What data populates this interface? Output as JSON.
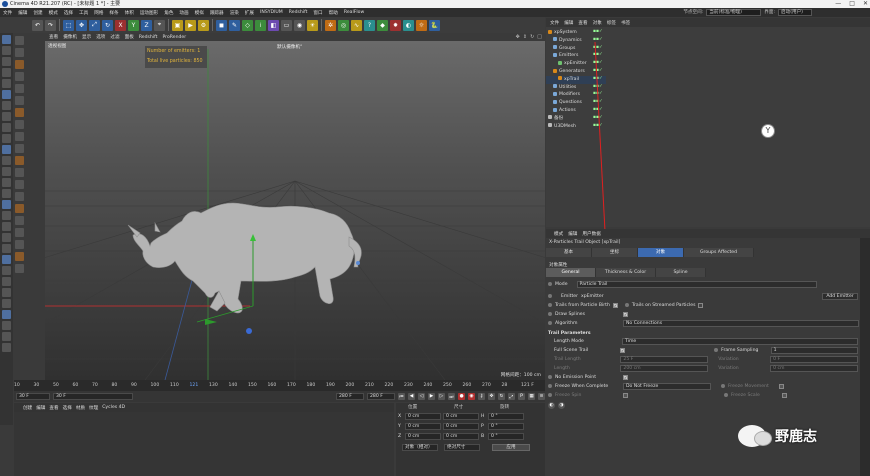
{
  "window": {
    "title": "Cinema 4D R21.207 (RC) - [未标题 1 *] - 主要",
    "controls": [
      "—",
      "□",
      "✕"
    ]
  },
  "menubar": {
    "items": [
      "文件",
      "编辑",
      "创建",
      "模式",
      "选择",
      "工具",
      "网格",
      "样条",
      "体积",
      "运动图形",
      "角色",
      "动画",
      "模拟",
      "跟踪器",
      "渲染",
      "扩展",
      "INSYDIUM",
      "Redshift",
      "窗口",
      "帮助",
      "RealFlow"
    ],
    "layout_label": "界面:",
    "layout_value": "启动(用户)",
    "node_label": "节点空间:",
    "node_value": "当前(标准/物理)"
  },
  "toolbar": {
    "icons": [
      "undo-icon",
      "redo-icon",
      "select-icon",
      "move-icon",
      "scale-icon",
      "rotate-icon",
      "x-axis-icon",
      "y-axis-icon",
      "z-axis-icon",
      "coord-icon",
      "render-view-icon",
      "render-icon",
      "render-settings-icon",
      "cube-icon",
      "pen-icon",
      "subdivision-icon",
      "array-icon",
      "deformer-icon",
      "floor-icon",
      "camera-icon",
      "light-icon",
      "xp-system-icon",
      "emitter-icon",
      "xp-trail-icon",
      "question-icon",
      "generator-icon",
      "explode-icon",
      "sky-icon",
      "sun-icon",
      "python-icon"
    ]
  },
  "viewport": {
    "menu": [
      "查看",
      "摄像机",
      "显示",
      "选项",
      "过滤",
      "面板",
      "Redshift",
      "ProRender"
    ],
    "view_name": "透视视图",
    "camera_name": "默认摄像机°",
    "hud": [
      "Number of emitters: 1",
      "Total live particles: 850"
    ],
    "grid_info": "网格间距：100 cm"
  },
  "timeline": {
    "ticks": [
      "10",
      "30",
      "50",
      "60",
      "70",
      "80",
      "90",
      "100",
      "110",
      "121",
      "130",
      "140",
      "150",
      "160",
      "170",
      "180",
      "190",
      "200",
      "210",
      "220",
      "230",
      "240",
      "250",
      "260",
      "270",
      "28",
      "121 F"
    ],
    "current_frame": "121",
    "start": "30 F",
    "start2": "30 F",
    "end": "280 F",
    "end2": "280 F"
  },
  "material_manager": {
    "menu": [
      "创建",
      "编辑",
      "查看",
      "选择",
      "材质",
      "纹理",
      "Cycles 4D"
    ]
  },
  "coordinates": {
    "headers": [
      "位置",
      "尺寸",
      "旋转"
    ],
    "rows": [
      {
        "axis": "X",
        "pos": "0 cm",
        "size": "0 cm",
        "rot_axis": "H",
        "rot": "0 °"
      },
      {
        "axis": "Y",
        "pos": "0 cm",
        "size": "0 cm",
        "rot_axis": "P",
        "rot": "0 °"
      },
      {
        "axis": "Z",
        "pos": "0 cm",
        "size": "0 cm",
        "rot_axis": "B",
        "rot": "0 °"
      }
    ],
    "mode1": "对象（相对）",
    "mode2": "绝对尺寸",
    "apply": "应用"
  },
  "object_manager": {
    "menu": [
      "文件",
      "编辑",
      "查看",
      "对象",
      "标签",
      "书签"
    ],
    "items": [
      {
        "name": "xpSystem",
        "color": "#d9891a",
        "indent": 0,
        "sel": false
      },
      {
        "name": "Dynamics",
        "color": "#7aa8d8",
        "indent": 1,
        "sel": false
      },
      {
        "name": "Groups",
        "color": "#7aa8d8",
        "indent": 1,
        "sel": false
      },
      {
        "name": "Emitters",
        "color": "#7aa8d8",
        "indent": 1,
        "sel": false
      },
      {
        "name": "xpEmitter",
        "color": "#6fc26f",
        "indent": 2,
        "sel": false
      },
      {
        "name": "Generators",
        "color": "#d9891a",
        "indent": 1,
        "sel": false
      },
      {
        "name": "xpTrail",
        "color": "#d9891a",
        "indent": 2,
        "sel": true
      },
      {
        "name": "Utilities",
        "color": "#7aa8d8",
        "indent": 1,
        "sel": false
      },
      {
        "name": "Modifiers",
        "color": "#7aa8d8",
        "indent": 1,
        "sel": false
      },
      {
        "name": "Questions",
        "color": "#7aa8d8",
        "indent": 1,
        "sel": false
      },
      {
        "name": "Actions",
        "color": "#7aa8d8",
        "indent": 1,
        "sel": false
      },
      {
        "name": "备份",
        "color": "#bbbbbb",
        "indent": 0,
        "sel": false
      },
      {
        "name": "U3DMesh",
        "color": "#bbbbbb",
        "indent": 0,
        "sel": false
      }
    ]
  },
  "attribute_manager": {
    "menu": [
      "模式",
      "编辑",
      "用户数据"
    ],
    "object_title": "X-Particles Trail Object [xpTrail]",
    "tabs": [
      "基本",
      "坐标",
      "对象",
      "Groups Affected"
    ],
    "active_tab": "对象",
    "section": "对象属性",
    "subtabs": [
      "General",
      "Thickness & Color",
      "Spline"
    ],
    "mode_label": "Mode",
    "mode_value": "Particle Trail",
    "emitter_label": "Emitter",
    "emitter_value": "xpEmitter",
    "add_emitter": "Add Emitter",
    "trails_birth": "Trails from Particle Birth",
    "trails_streamed": "Trails on Streamed Particles",
    "draw_splines": "Draw Splines",
    "algorithm_label": "Algorithm",
    "algorithm_value": "No Connections",
    "trail_params": "Trail Parameters",
    "length_mode_label": "Length Mode",
    "length_mode_value": "Time",
    "full_scene": "Full Scene Trail",
    "frame_sampling_label": "Frame Sampling",
    "frame_sampling_value": "1",
    "trail_length": "Trail Length",
    "trail_length_val": "25 F",
    "variation": "Variation",
    "variation_val": "0 F",
    "length": "Length",
    "length_val": "200 cm",
    "variation2_val": "0 cm",
    "no_emission": "No Emission Point",
    "freeze_label": "Freeze When Complete",
    "freeze_value": "Do Not Freeze",
    "freeze_movement": "Freeze Movement",
    "freeze_spin": "Freeze Spin",
    "freeze_scale": "Freeze Scale"
  },
  "watermark": {
    "text": "野鹿志"
  }
}
